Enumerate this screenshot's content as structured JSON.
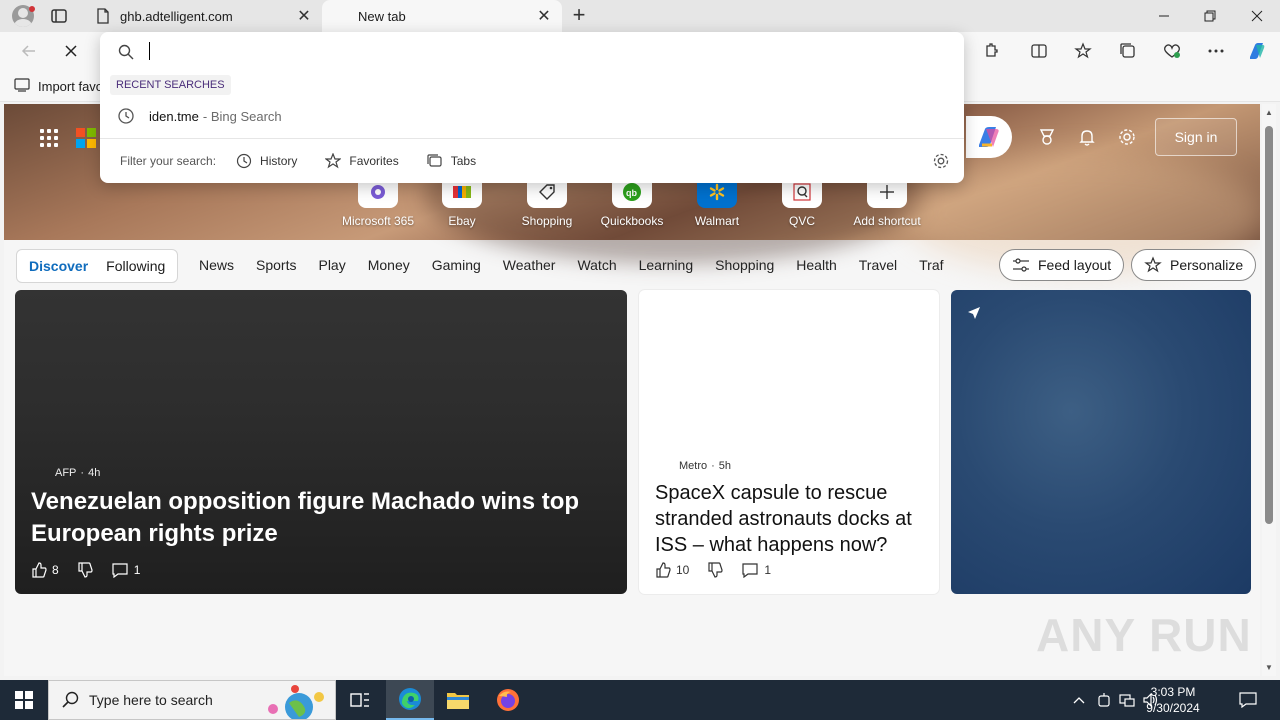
{
  "browser": {
    "tabs": [
      {
        "title": "ghb.adtelligent.com",
        "active": false
      },
      {
        "title": "New tab",
        "active": true
      }
    ],
    "favorites_bar": {
      "import_label": "Import favo"
    }
  },
  "omnibox": {
    "value": "",
    "recent_label": "RECENT SEARCHES",
    "recent": [
      {
        "query": "iden.tme",
        "suffix": "- Bing Search"
      }
    ],
    "filter_label": "Filter your search:",
    "filters": [
      "History",
      "Favorites",
      "Tabs"
    ]
  },
  "hero": {
    "signin_label": "Sign in",
    "shortcuts": [
      {
        "label": "Microsoft 365"
      },
      {
        "label": "Ebay"
      },
      {
        "label": "Shopping"
      },
      {
        "label": "Quickbooks"
      },
      {
        "label": "Walmart"
      },
      {
        "label": "QVC"
      },
      {
        "label": "Add shortcut"
      }
    ]
  },
  "feed": {
    "segments": [
      "Discover",
      "Following"
    ],
    "categories": [
      "News",
      "Sports",
      "Play",
      "Money",
      "Gaming",
      "Weather",
      "Watch",
      "Learning",
      "Shopping",
      "Health",
      "Travel",
      "Traf"
    ],
    "feed_layout_label": "Feed layout",
    "personalize_label": "Personalize",
    "cards": [
      {
        "source": "AFP",
        "age": "4h",
        "headline": "Venezuelan opposition figure Machado wins top European rights prize",
        "likes": "8",
        "comments": "1"
      },
      {
        "source": "Metro",
        "age": "5h",
        "headline": "SpaceX capsule to rescue stranded astronauts docks at ISS – what happens now?",
        "likes": "10",
        "comments": "1"
      }
    ]
  },
  "watermark": "ANY RUN",
  "taskbar": {
    "search_placeholder": "Type here to search",
    "time": "3:03 PM",
    "date": "9/30/2024"
  },
  "colors": {
    "accent": "#0f6cbd",
    "taskbar": "#1e2a38"
  }
}
